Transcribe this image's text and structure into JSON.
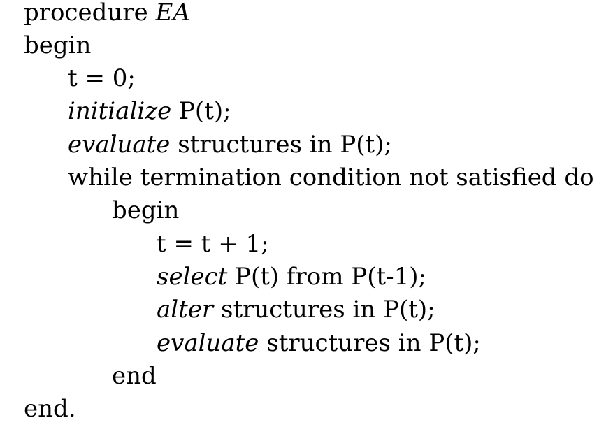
{
  "procedure": {
    "keyword": "procedure",
    "name": "EA"
  },
  "lines": {
    "begin_outer": "begin",
    "t_init": "t = 0;",
    "initialize_kw": "initialize",
    "initialize_rest": " P(t);",
    "evaluate1_kw": "evaluate",
    "evaluate1_rest": " structures in P(t);",
    "while": "while termination condition not satisfied do",
    "begin_inner": "begin",
    "t_inc": "t = t + 1;",
    "select_kw": "select",
    "select_rest": " P(t) from P(t-1);",
    "alter_kw": "alter",
    "alter_rest": " structures in P(t);",
    "evaluate2_kw": "evaluate",
    "evaluate2_rest": " structures in P(t);",
    "end_inner": "end",
    "end_outer": "end."
  }
}
